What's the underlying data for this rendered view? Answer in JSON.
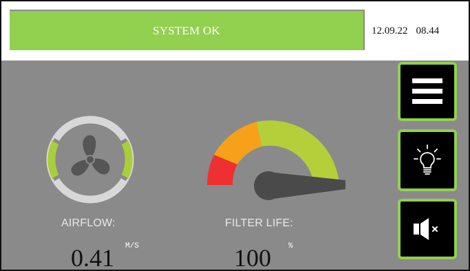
{
  "header": {
    "status": "SYSTEM OK",
    "date": "12.09.22",
    "time": "08.44"
  },
  "sidebar": {
    "buttons": [
      {
        "icon": "hamburger-menu-icon"
      },
      {
        "icon": "lightbulb-icon"
      },
      {
        "icon": "speaker-mute-icon"
      }
    ]
  },
  "airflow": {
    "label": "AIRFLOW:",
    "value": "0.41",
    "unit": "M/S",
    "icon": "fan-icon"
  },
  "filter": {
    "label": "FILTER LIFE:",
    "value": "100",
    "unit": "%",
    "level_percent": 100
  },
  "colors": {
    "accent_green": "#92d050",
    "screen_gray": "#8a8a8a",
    "gauge_red": "#ee3030",
    "gauge_orange": "#f7a11a",
    "gauge_green": "#b5cf3a",
    "needle": "#4a4a4a"
  }
}
